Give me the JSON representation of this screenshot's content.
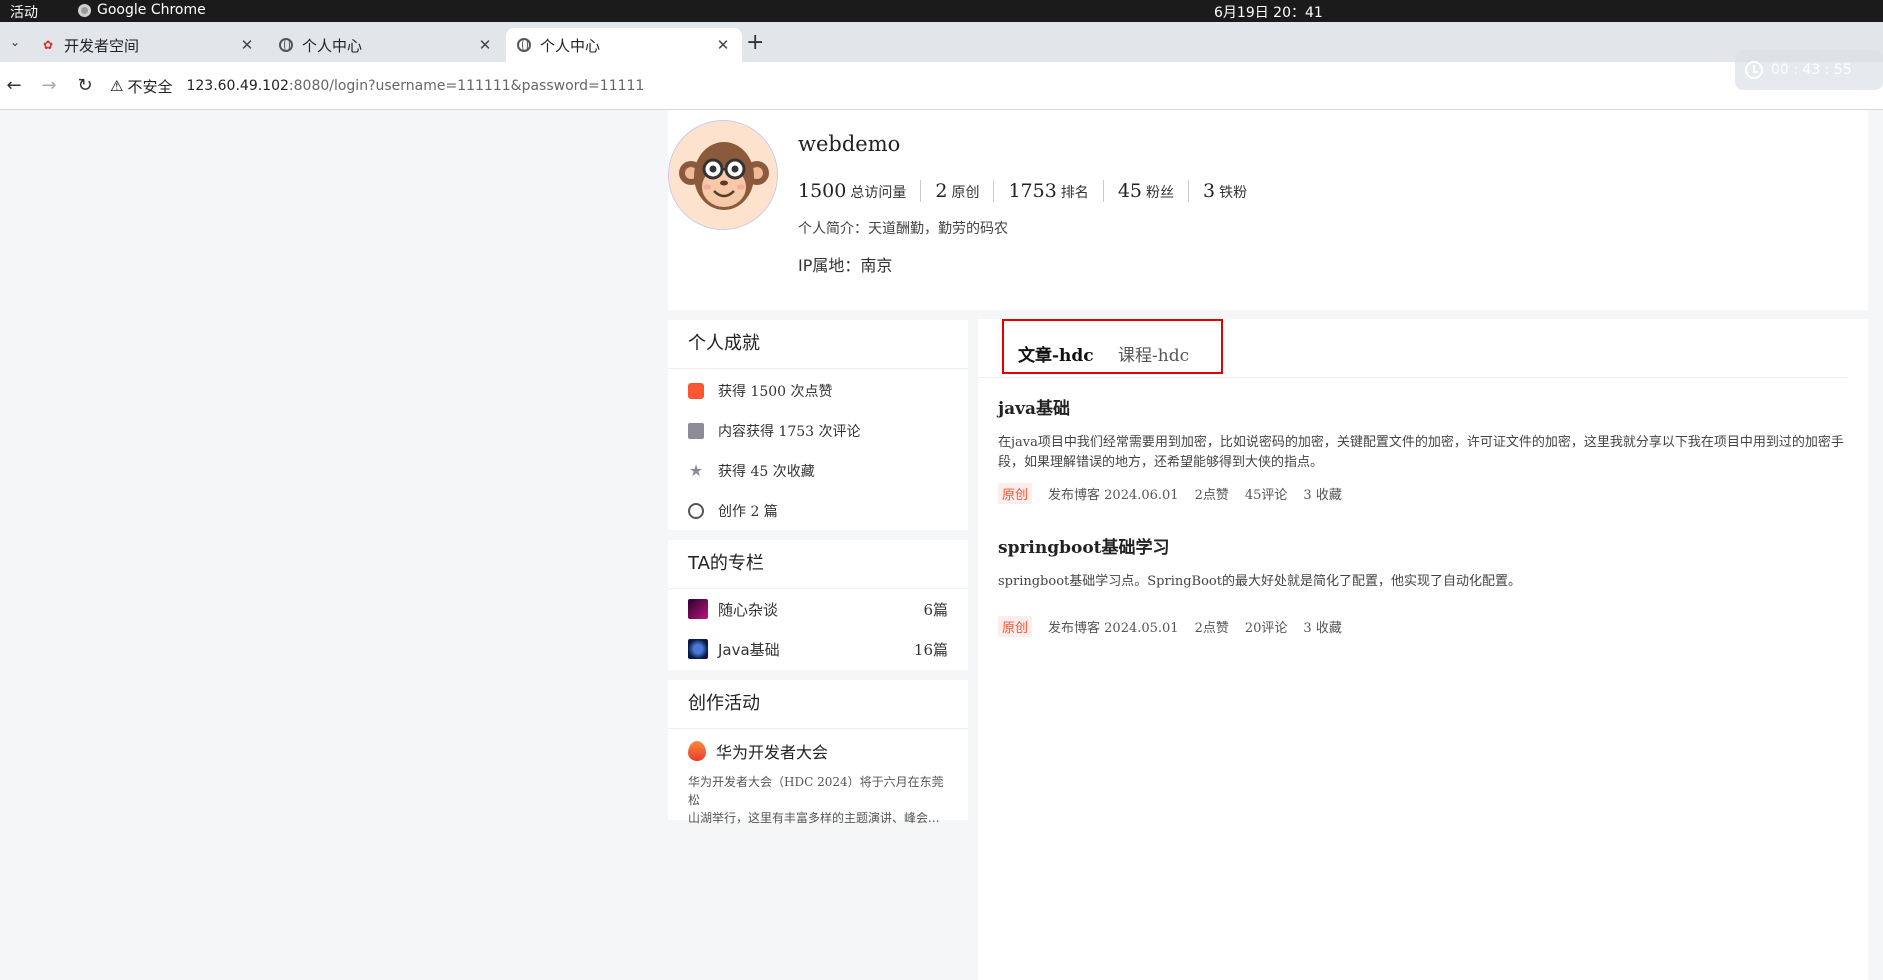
{
  "system": {
    "activities": "活动",
    "app_name": "Google Chrome",
    "clock": "6月19日  20：41"
  },
  "browser": {
    "tabs": [
      {
        "title": "开发者空间",
        "icon": "huawei-icon"
      },
      {
        "title": "个人中心",
        "icon": "globe-icon"
      },
      {
        "title": "个人中心",
        "icon": "globe-icon",
        "active": true
      }
    ],
    "security_label": "不安全",
    "url_host": "123.60.49.102",
    "url_rest": ":8080/login?username=111111&password=11111",
    "timer": "00 : 43 : 55"
  },
  "profile": {
    "username": "webdemo",
    "stats": [
      {
        "value": "1500",
        "label": "总访问量"
      },
      {
        "value": "2",
        "label": "原创"
      },
      {
        "value": "1753",
        "label": "排名"
      },
      {
        "value": "45",
        "label": "粉丝"
      },
      {
        "value": "3",
        "label": "铁粉"
      }
    ],
    "bio": "个人简介：天道酬勤，勤劳的码农",
    "ip": "IP属地：南京"
  },
  "achievements": {
    "heading": "个人成就",
    "items": [
      {
        "icon": "thumb-up-icon",
        "text": "获得 1500 次点赞"
      },
      {
        "icon": "comment-icon",
        "text": "内容获得 1753 次评论"
      },
      {
        "icon": "star-icon",
        "text": "获得 45 次收藏"
      },
      {
        "icon": "bulb-icon",
        "text": "创作 2 篇"
      }
    ]
  },
  "columns": {
    "heading": "TA的专栏",
    "items": [
      {
        "name": "随心杂谈",
        "count": "6篇"
      },
      {
        "name": "Java基础",
        "count": "16篇"
      }
    ]
  },
  "activity": {
    "heading": "创作活动",
    "title": "华为开发者大会",
    "desc_line1": "华为开发者大会（HDC 2024）将于六月在东莞松",
    "desc_line2": "山湖举行，这里有丰富多样的主题演讲、峰会..."
  },
  "content_tabs": {
    "articles": "文章-hdc",
    "courses": "课程-hdc"
  },
  "articles": [
    {
      "title": "java基础",
      "desc": "在java项目中我们经常需要用到加密，比如说密码的加密，关键配置文件的加密，许可证文件的加密，这里我就分享以下我在项目中用到过的加密手段，如果理解错误的地方，还希望能够得到大侠的指点。",
      "badge": "原创",
      "date": "发布博客 2024.06.01",
      "likes": "2点赞",
      "comments": "45评论",
      "favorites": "3 收藏"
    },
    {
      "title": "springboot基础学习",
      "desc": "springboot基础学习点。SpringBoot的最大好处就是简化了配置，他实现了自动化配置。",
      "badge": "原创",
      "date": "发布博客 2024.05.01",
      "likes": "2点赞",
      "comments": "20评论",
      "favorites": "3 收藏"
    }
  ],
  "colors": {
    "accent": "#fc5531",
    "highlight_border": "#e50000"
  }
}
